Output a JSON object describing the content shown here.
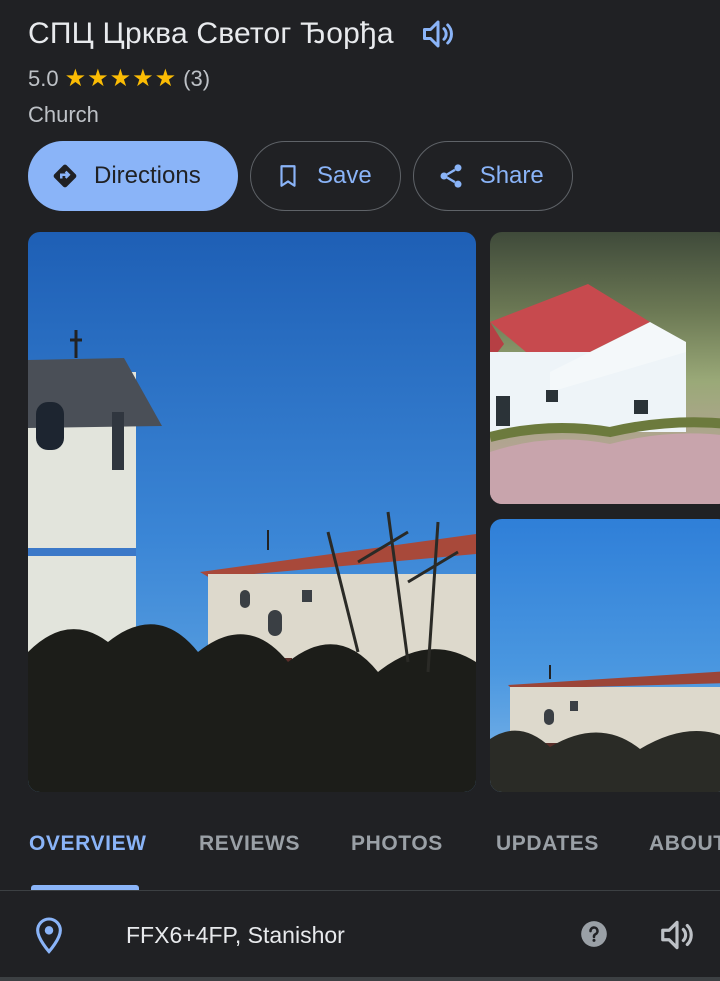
{
  "place": {
    "title": "СПЦ Црква Светог Ђорђа",
    "rating": "5.0",
    "stars": 5,
    "review_count": "(3)",
    "category": "Church"
  },
  "actions": {
    "directions": "Directions",
    "save": "Save",
    "share": "Share"
  },
  "tabs": [
    "OVERVIEW",
    "REVIEWS",
    "PHOTOS",
    "UPDATES",
    "ABOUT"
  ],
  "active_tab": "OVERVIEW",
  "location": {
    "plus_code": "FFX6+4FP, Stanishor"
  },
  "colors": {
    "accent": "#8ab4f8",
    "star": "#fbbc04",
    "background": "#202124"
  },
  "icons": {
    "title_speaker": "speaker-icon",
    "directions": "directions-icon",
    "save": "bookmark-icon",
    "share": "share-icon",
    "location": "location-pin-icon",
    "help": "help-icon",
    "location_speaker": "speaker-icon"
  }
}
